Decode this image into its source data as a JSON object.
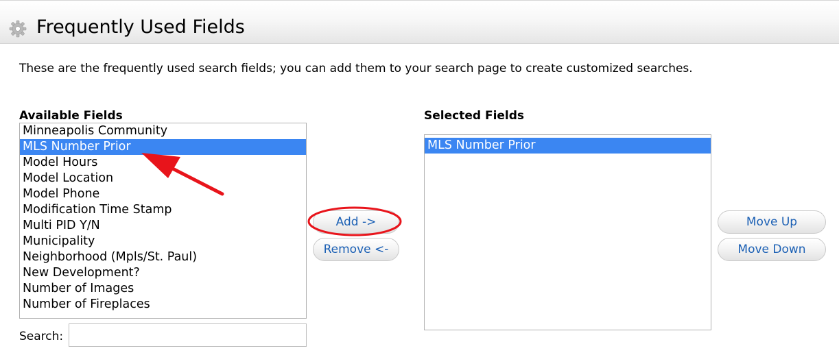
{
  "header": {
    "title": "Frequently Used Fields",
    "icon": "gear-icon"
  },
  "description": "These are the frequently used search fields; you can add them to your search page to create customized searches.",
  "available": {
    "label": "Available Fields",
    "items": [
      "Minneapolis Community",
      "MLS Number Prior",
      "Model Hours",
      "Model Location",
      "Model Phone",
      "Modification Time Stamp",
      "Multi PID Y/N",
      "Municipality",
      "Neighborhood (Mpls/St. Paul)",
      "New Development?",
      "Number of Images",
      "Number of Fireplaces"
    ],
    "selected_item": "MLS Number Prior"
  },
  "selected": {
    "label": "Selected Fields",
    "items": [
      "MLS Number Prior"
    ],
    "selected_item": "MLS Number Prior"
  },
  "buttons": {
    "add": "Add ->",
    "remove": "Remove <-",
    "move_up": "Move Up",
    "move_down": "Move Down"
  },
  "search": {
    "label": "Search:",
    "value": ""
  },
  "colors": {
    "selection": "#3b86f2",
    "button_text": "#1a5fb4",
    "annotation": "#e8141b"
  }
}
